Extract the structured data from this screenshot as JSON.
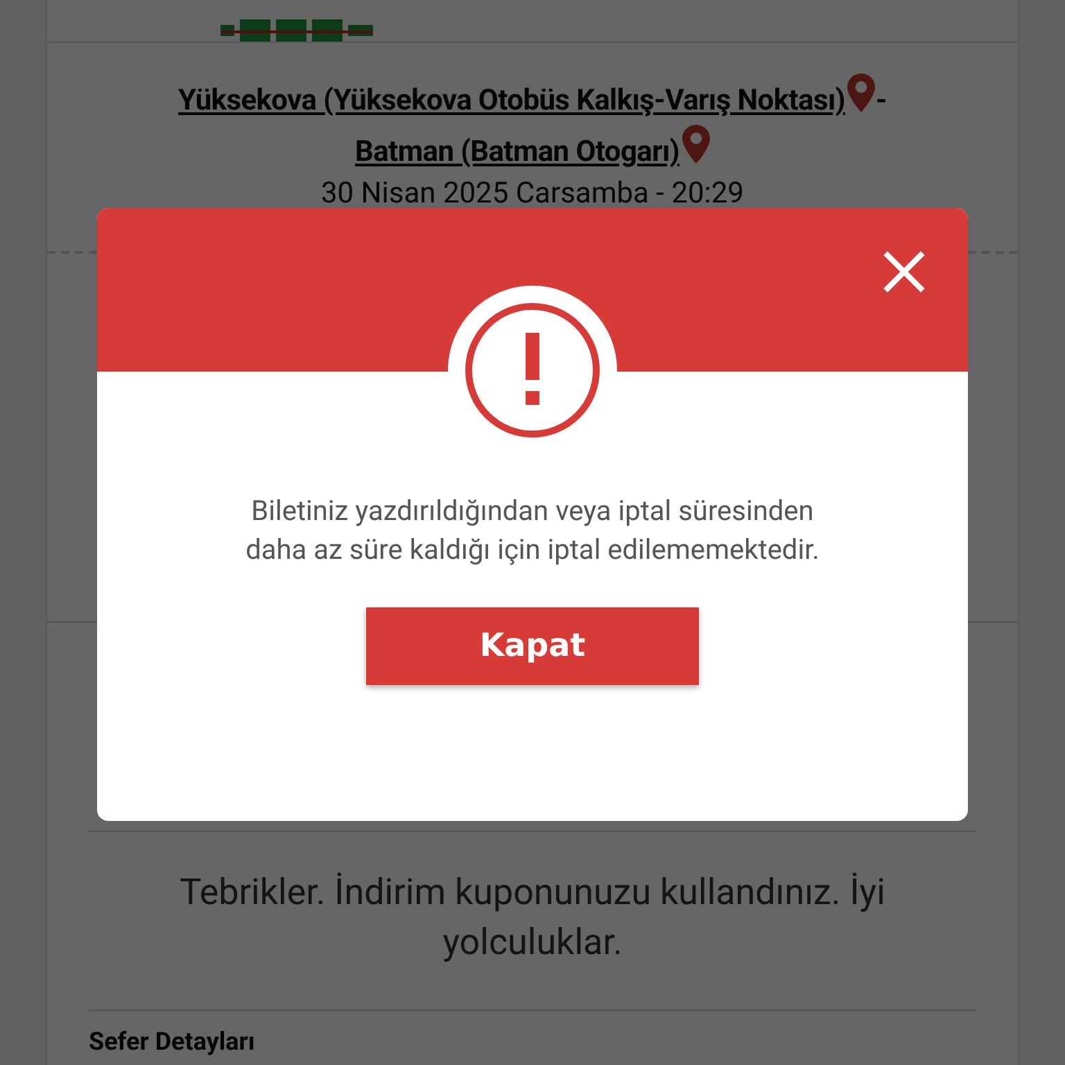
{
  "trip": {
    "origin": "Yüksekova (Yüksekova Otobüs Kalkış-Varış Noktası)",
    "separator": "-",
    "destination": "Batman (Batman Otogarı)",
    "date": "30 Nisan 2025 Carsamba - 20:29"
  },
  "coupon_message": "Tebrikler. İndirim kuponunuzu kullandınız. İyi yolculuklar.",
  "section_title": "Sefer Detayları",
  "dialog": {
    "message": "Biletiniz yazdırıldığından veya iptal süresinden daha az süre kaldığı için iptal edilememektedir.",
    "button": "Kapat"
  }
}
